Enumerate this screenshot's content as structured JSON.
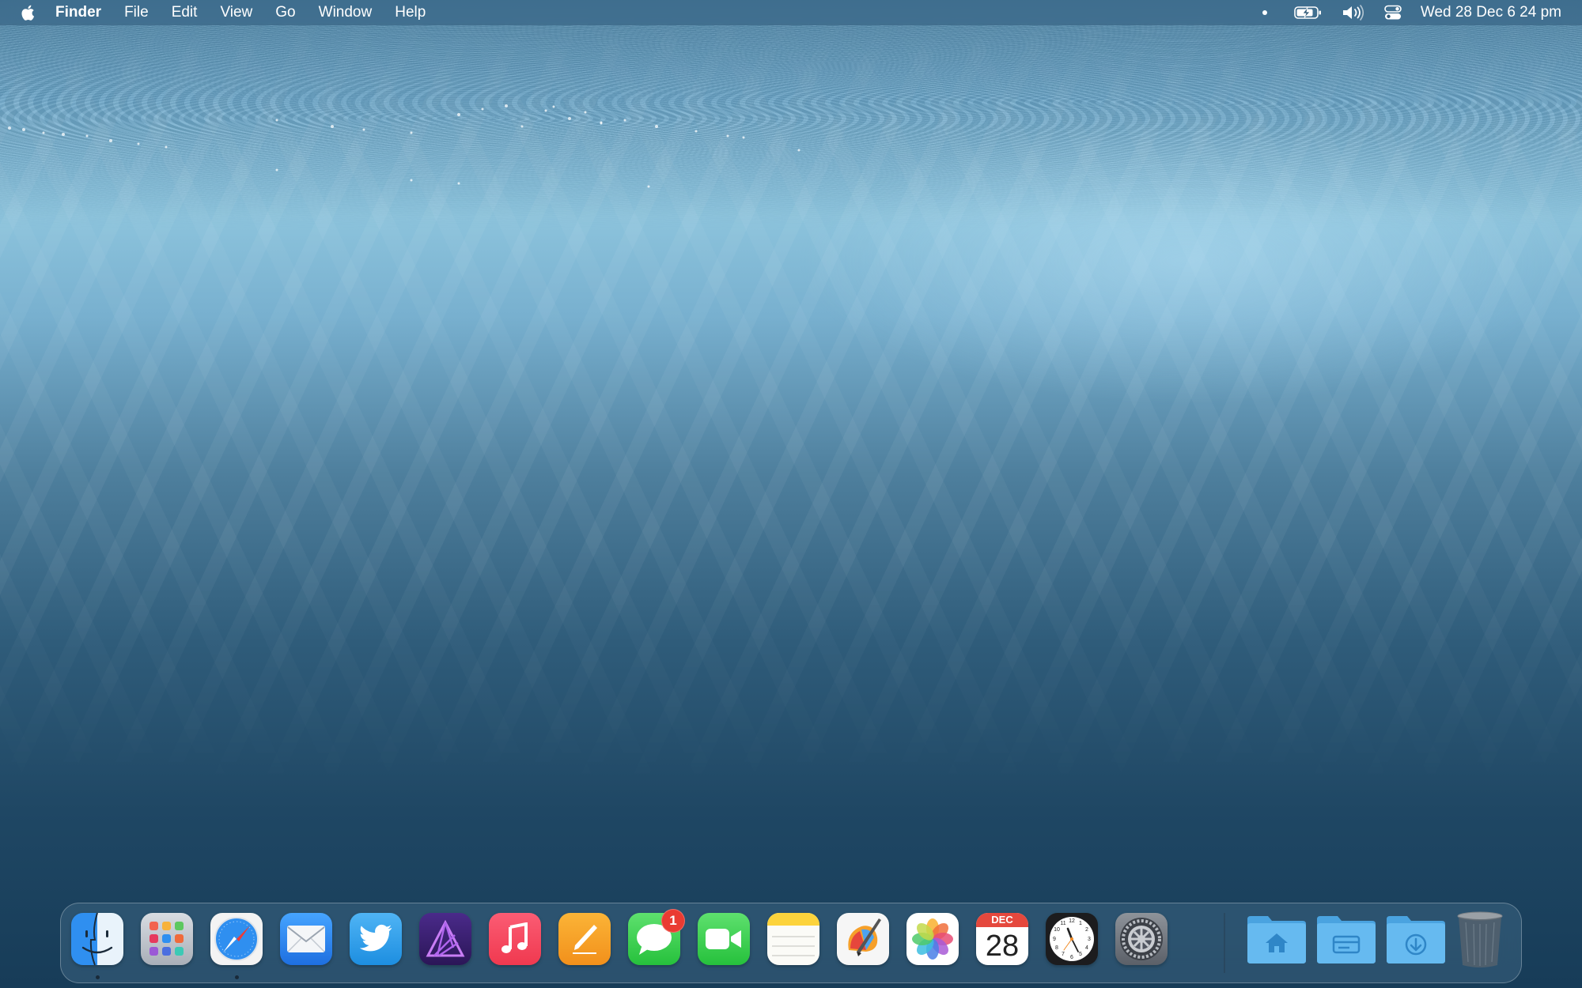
{
  "menubar": {
    "apple_icon": "apple-logo-icon",
    "app_name": "Finder",
    "items": [
      "File",
      "Edit",
      "View",
      "Go",
      "Window",
      "Help"
    ],
    "status": {
      "battery_icon": "battery-charging-icon",
      "volume_icon": "volume-icon",
      "control_center_icon": "control-center-icon",
      "datetime": "Wed 28 Dec  6 24 pm"
    }
  },
  "dock": {
    "apps": [
      {
        "name": "Finder",
        "icon": "finder-icon",
        "running": true
      },
      {
        "name": "Launchpad",
        "icon": "launchpad-icon",
        "running": false
      },
      {
        "name": "Safari",
        "icon": "safari-icon",
        "running": true
      },
      {
        "name": "Mail",
        "icon": "mail-icon",
        "running": false
      },
      {
        "name": "Twitter",
        "icon": "twitter-icon",
        "running": false
      },
      {
        "name": "Affinity Photo",
        "icon": "affinity-photo-icon",
        "running": false
      },
      {
        "name": "Music",
        "icon": "music-icon",
        "running": false
      },
      {
        "name": "Pages",
        "icon": "pages-icon",
        "running": false
      },
      {
        "name": "Messages",
        "icon": "messages-icon",
        "running": false,
        "badge": "1"
      },
      {
        "name": "FaceTime",
        "icon": "facetime-icon",
        "running": false
      },
      {
        "name": "Notes",
        "icon": "notes-icon",
        "running": false
      },
      {
        "name": "Pixelmator Pro",
        "icon": "pixelmator-icon",
        "running": false
      },
      {
        "name": "Photos",
        "icon": "photos-icon",
        "running": false
      },
      {
        "name": "Calendar",
        "icon": "calendar-icon",
        "running": false
      },
      {
        "name": "Clock",
        "icon": "clock-icon",
        "running": false
      },
      {
        "name": "System Preferences",
        "icon": "system-preferences-icon",
        "running": false
      }
    ],
    "calendar": {
      "month": "DEC",
      "day": "28"
    },
    "messages_badge": "1",
    "folders": [
      {
        "name": "Home",
        "icon": "home-folder-icon"
      },
      {
        "name": "Applications",
        "icon": "applications-folder-icon"
      },
      {
        "name": "Downloads",
        "icon": "downloads-folder-icon"
      }
    ],
    "trash_icon": "trash-icon",
    "colors": {
      "finder_blue": "#2f8ff0",
      "music_red": "#f5475a",
      "pages_orange": "#f4a025",
      "messages_green": "#3fd55a",
      "folder_blue": "#5ab3ea",
      "badge_red": "#ea3b32"
    }
  }
}
